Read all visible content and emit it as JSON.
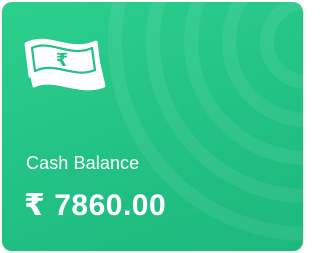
{
  "card": {
    "label": "Cash Balance",
    "amount": "₹ 7860.00",
    "icon": "banknote-rupee-icon",
    "colors": {
      "background": "#22c184",
      "text": "#ffffff"
    }
  }
}
